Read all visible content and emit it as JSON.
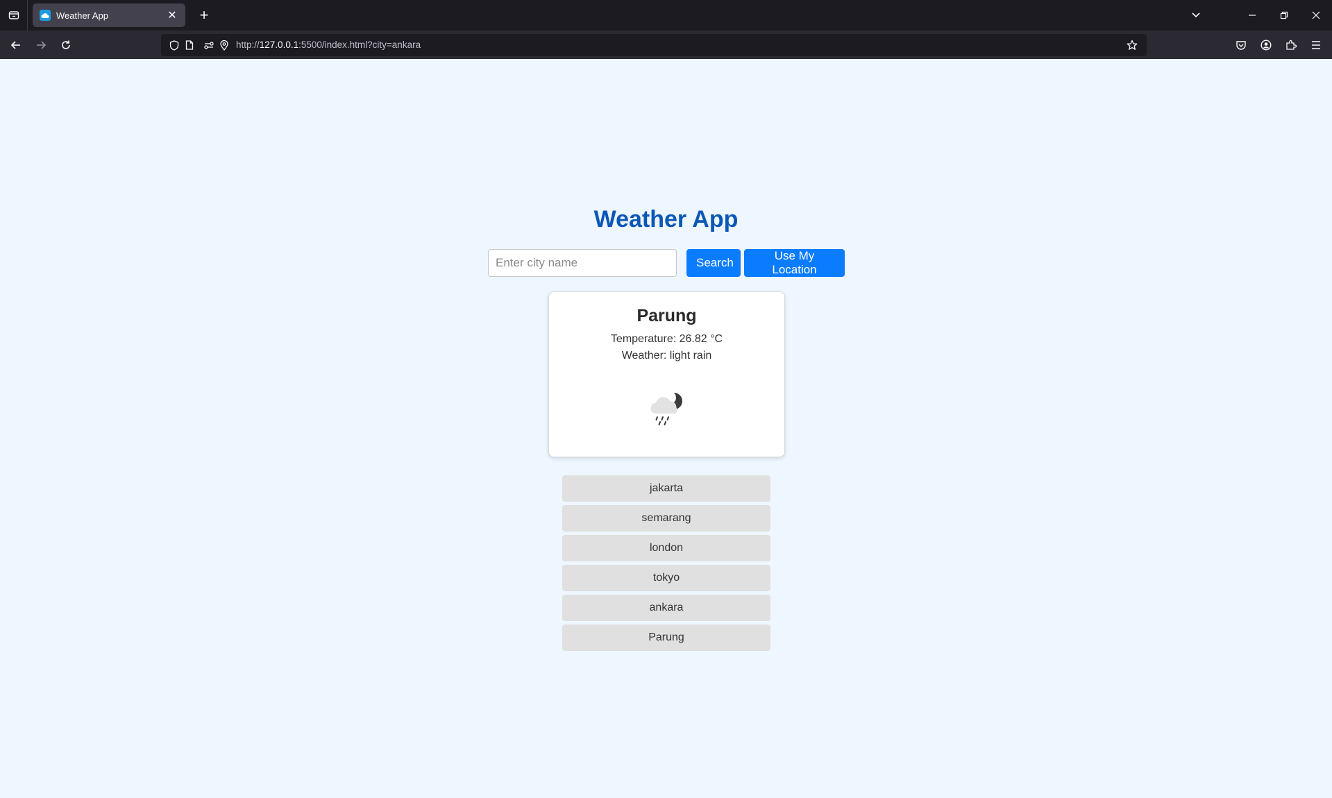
{
  "browser": {
    "tab_title": "Weather App",
    "url_prefix": "http://",
    "url_host": "127.0.0.1",
    "url_rest": ":5500/index.html?city=ankara"
  },
  "app": {
    "title": "Weather App",
    "search": {
      "placeholder": "Enter city name",
      "value": "",
      "search_label": "Search",
      "location_label": "Use My Location"
    },
    "current": {
      "city": "Parung",
      "temperature_text": "Temperature: 26.82 °C",
      "weather_text": "Weather: light rain",
      "icon": "rain-night-icon"
    },
    "history": [
      "jakarta",
      "semarang",
      "london",
      "tokyo",
      "ankara",
      "Parung"
    ]
  },
  "colors": {
    "accent": "#0a7cff",
    "title": "#0b57b8",
    "page_bg": "#eef6ff"
  }
}
